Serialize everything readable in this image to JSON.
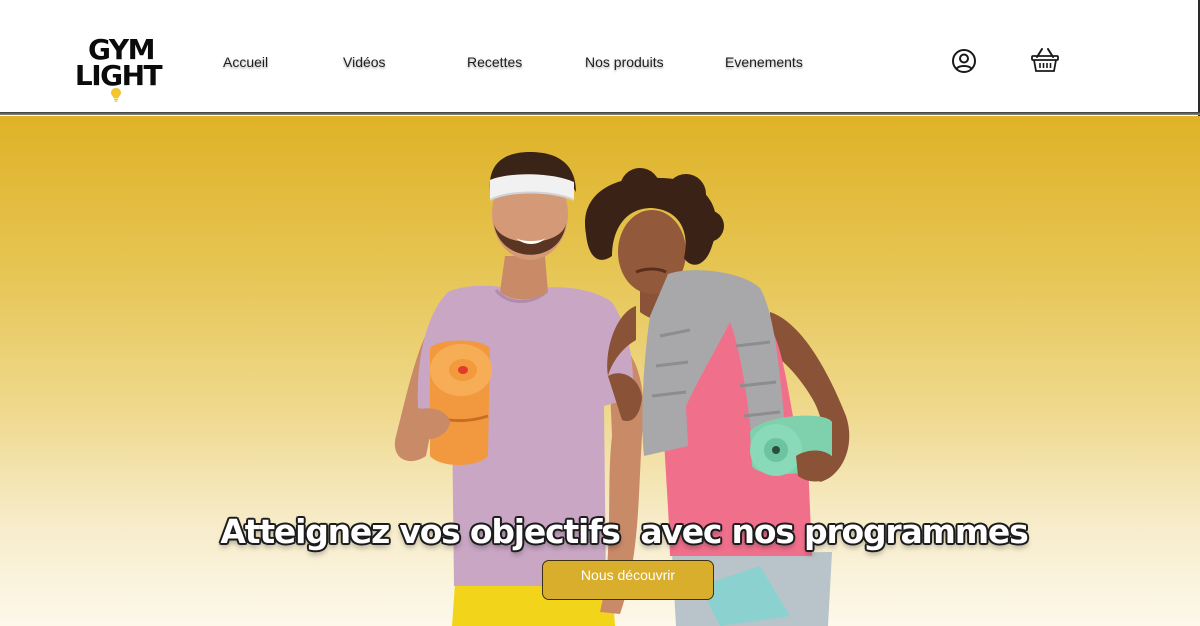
{
  "brand": {
    "logo_line1": "GYM",
    "logo_line2": "LIGHT",
    "logo_text_color": "#0b0b0b",
    "logo_accent_color": "#f2c531"
  },
  "nav": {
    "items": [
      {
        "label": "Accueil"
      },
      {
        "label": "Vidéos"
      },
      {
        "label": "Recettes"
      },
      {
        "label": "Nos produits"
      },
      {
        "label": "Evenements"
      }
    ]
  },
  "header_icons": {
    "account": "user-circle-icon",
    "cart": "shopping-basket-icon"
  },
  "hero": {
    "title": "Atteignez vos objectifs  avec nos programmes",
    "cta_label": "Nous découvrir",
    "photo": "man-and-woman-holding-yoga-mats-photo",
    "background_top_color": "#dfb227",
    "background_bottom_color": "#fdf8ea",
    "cta_color": "#d8ae2c"
  }
}
